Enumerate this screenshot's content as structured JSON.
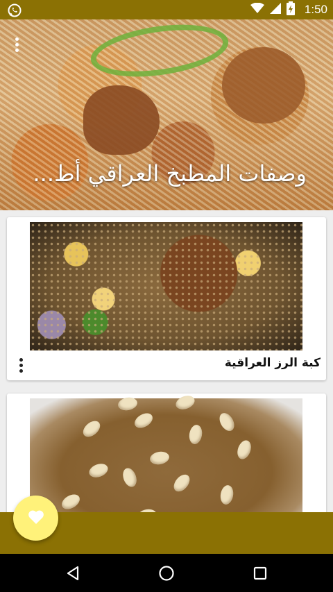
{
  "status_bar": {
    "time": "1:50",
    "battery_level": "",
    "icons": [
      "whatsapp-icon",
      "wifi-icon",
      "signal-icon",
      "battery-icon"
    ]
  },
  "header": {
    "title": "وصفات المطبخ العراقي أط...",
    "menu_icon": "more-vert-icon"
  },
  "recipes": [
    {
      "title": "كبة الرز العراقية"
    },
    {
      "title": ""
    }
  ],
  "fab": {
    "icon": "heart-icon"
  },
  "nav_bar": {
    "buttons": [
      "back-icon",
      "home-icon",
      "recents-icon"
    ]
  },
  "colors": {
    "accent": "#8b7104",
    "fab": "#fff27a",
    "nav": "#000000"
  }
}
